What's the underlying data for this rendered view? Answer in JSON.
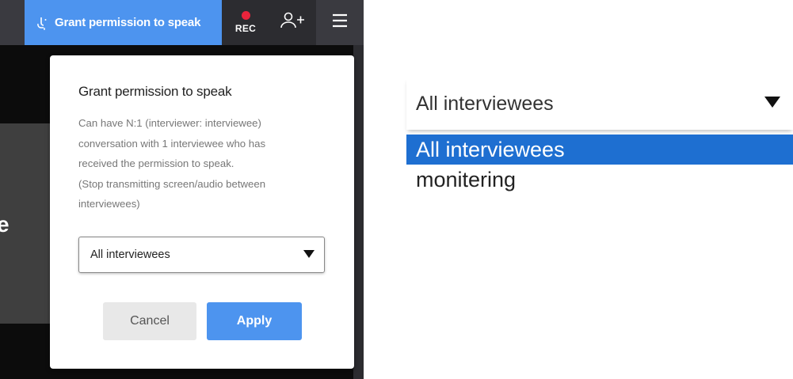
{
  "toolbar": {
    "grant_label": "Grant permission to speak",
    "rec_label": "REC",
    "accent_color": "#4d94ef",
    "rec_dot_color": "#e8243c",
    "icons": [
      "microphone-icon",
      "record-dot-icon",
      "add-user-icon",
      "hamburger-menu-icon"
    ]
  },
  "background": {
    "edge_text": "e"
  },
  "dialog": {
    "title": "Grant permission to speak",
    "description": [
      "Can have N:1 (interviewer: interviewee)",
      "conversation with 1 interviewee who has",
      "received the permission to speak.",
      "(Stop transmitting screen/audio between",
      "interviewees)"
    ],
    "select_value": "All interviewees",
    "cancel_label": "Cancel",
    "apply_label": "Apply"
  },
  "zoomed_dropdown": {
    "selected_value": "All interviewees",
    "options": [
      "All interviewees",
      "monitering"
    ],
    "highlight_color": "#1e6fd1"
  }
}
